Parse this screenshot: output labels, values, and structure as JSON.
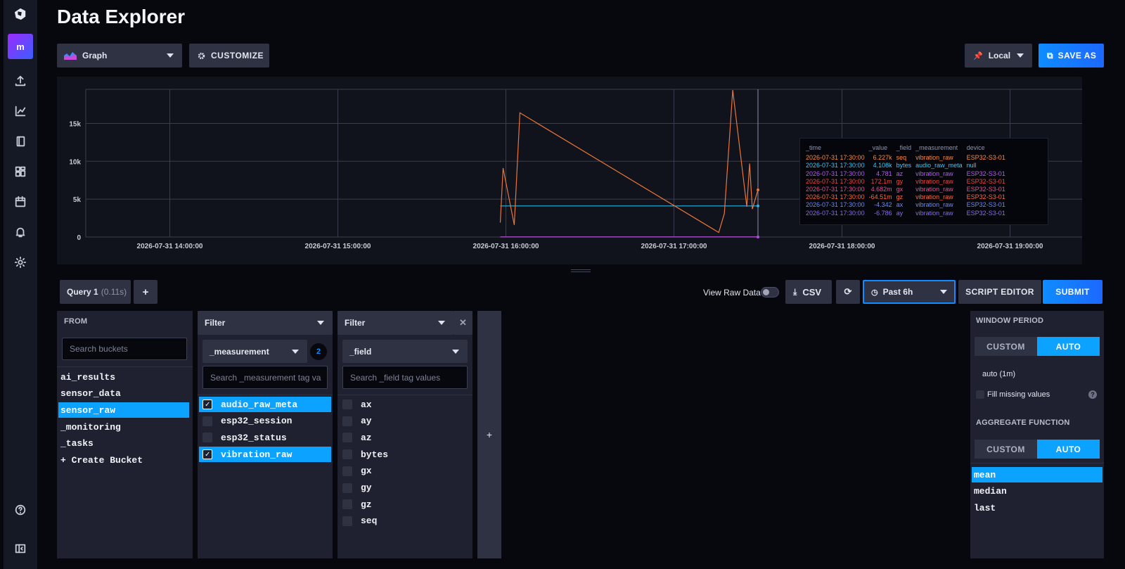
{
  "page": {
    "title": "Data Explorer"
  },
  "nav": {
    "org_initial": "m"
  },
  "toolbar": {
    "vis_type": "Graph",
    "customize": "CUSTOMIZE",
    "timezone": "Local",
    "save_as": "SAVE AS"
  },
  "chart_data": {
    "type": "line",
    "x_ticks": [
      "2026-07-31 14:00:00",
      "2026-07-31 15:00:00",
      "2026-07-31 16:00:00",
      "2026-07-31 17:00:00",
      "2026-07-31 18:00:00",
      "2026-07-31 19:00:00"
    ],
    "y_ticks": [
      "0",
      "5k",
      "10k",
      "15k"
    ],
    "ylim": [
      0,
      19500
    ],
    "grid": true,
    "series": [
      {
        "name": "seq",
        "color": "#e8763a",
        "points": [
          [
            "2026-07-31 15:58",
            1900
          ],
          [
            "2026-07-31 15:59",
            9100
          ],
          [
            "2026-07-31 16:03",
            1600
          ],
          [
            "2026-07-31 16:05",
            16400
          ],
          [
            "2026-07-31 17:16",
            600
          ],
          [
            "2026-07-31 17:18",
            3100
          ],
          [
            "2026-07-31 17:21",
            19400
          ],
          [
            "2026-07-31 17:26",
            4000
          ],
          [
            "2026-07-31 17:27",
            9700
          ],
          [
            "2026-07-31 17:28",
            3700
          ],
          [
            "2026-07-31 17:30",
            6227
          ]
        ]
      },
      {
        "name": "bytes",
        "color": "#2bb4e6",
        "points": [
          [
            "2026-07-31 15:58",
            4108
          ],
          [
            "2026-07-31 17:30",
            4108
          ]
        ]
      },
      {
        "name": "az",
        "color": "#a64bde",
        "points": [
          [
            "2026-07-31 15:58",
            5
          ],
          [
            "2026-07-31 17:30",
            4.781
          ]
        ]
      },
      {
        "name": "gx",
        "color": "#d94f7a",
        "points": [
          [
            "2026-07-31 15:58",
            5
          ],
          [
            "2026-07-31 17:30",
            4.682
          ]
        ]
      }
    ]
  },
  "legend": {
    "headers": [
      "_time",
      "_value",
      "_field",
      "_measurement",
      "device"
    ],
    "rows": [
      {
        "time": "2026-07-31 17:30:00",
        "value": "6.227k",
        "field": "seq",
        "measurement": "vibration_raw",
        "device": "ESP32-S3-01",
        "color": "#ff8a3d"
      },
      {
        "time": "2026-07-31 17:30:00",
        "value": "4.108k",
        "field": "bytes",
        "measurement": "audio_raw_meta",
        "device": "null",
        "color": "#3fc6f5"
      },
      {
        "time": "2026-07-31 17:30:00",
        "value": "4.781",
        "field": "az",
        "measurement": "vibration_raw",
        "device": "ESP32-S3-01",
        "color": "#b45cf0"
      },
      {
        "time": "2026-07-31 17:30:00",
        "value": "172.1m",
        "field": "gy",
        "measurement": "vibration_raw",
        "device": "ESP32-S3-01",
        "color": "#f0453e"
      },
      {
        "time": "2026-07-31 17:30:00",
        "value": "4.682m",
        "field": "gx",
        "measurement": "vibration_raw",
        "device": "ESP32-S3-01",
        "color": "#e0528f"
      },
      {
        "time": "2026-07-31 17:30:00",
        "value": "-64.51m",
        "field": "gz",
        "measurement": "vibration_raw",
        "device": "ESP32-S3-01",
        "color": "#ff6a3a"
      },
      {
        "time": "2026-07-31 17:30:00",
        "value": "-4.342",
        "field": "ax",
        "measurement": "vibration_raw",
        "device": "ESP32-S3-01",
        "color": "#6a8cf5"
      },
      {
        "time": "2026-07-31 17:30:00",
        "value": "-6.786",
        "field": "ay",
        "measurement": "vibration_raw",
        "device": "ESP32-S3-01",
        "color": "#8a6cf0"
      }
    ]
  },
  "query_bar": {
    "tab_label": "Query 1",
    "tab_time": "(0.11s)",
    "add_tab": "+",
    "view_raw": "View Raw Data",
    "csv": "CSV",
    "time_range": "Past 6h",
    "script_editor": "SCRIPT EDITOR",
    "submit": "SUBMIT"
  },
  "from": {
    "label": "FROM",
    "search_placeholder": "Search buckets",
    "buckets": [
      "ai_results",
      "sensor_data",
      "sensor_raw",
      "_monitoring",
      "_tasks",
      "+ Create Bucket"
    ],
    "selected_index": 2
  },
  "filter1": {
    "type": "Filter",
    "key": "_measurement",
    "count": "2",
    "search_placeholder": "Search _measurement tag va",
    "values": [
      {
        "label": "audio_raw_meta",
        "checked": true
      },
      {
        "label": "esp32_session",
        "checked": false
      },
      {
        "label": "esp32_status",
        "checked": false
      },
      {
        "label": "vibration_raw",
        "checked": true
      }
    ]
  },
  "filter2": {
    "type": "Filter",
    "key": "_field",
    "close": "✕",
    "search_placeholder": "Search _field tag values",
    "values": [
      "ax",
      "ay",
      "az",
      "bytes",
      "gx",
      "gy",
      "gz",
      "seq"
    ]
  },
  "add_filter": "+",
  "window": {
    "label": "WINDOW PERIOD",
    "custom": "CUSTOM",
    "auto": "AUTO",
    "auto_value": "auto (1m)",
    "fill_missing": "Fill missing values",
    "help": "?"
  },
  "aggregate": {
    "label": "AGGREGATE FUNCTION",
    "custom": "CUSTOM",
    "auto": "AUTO",
    "functions": [
      "mean",
      "median",
      "last"
    ],
    "selected_index": 0
  }
}
